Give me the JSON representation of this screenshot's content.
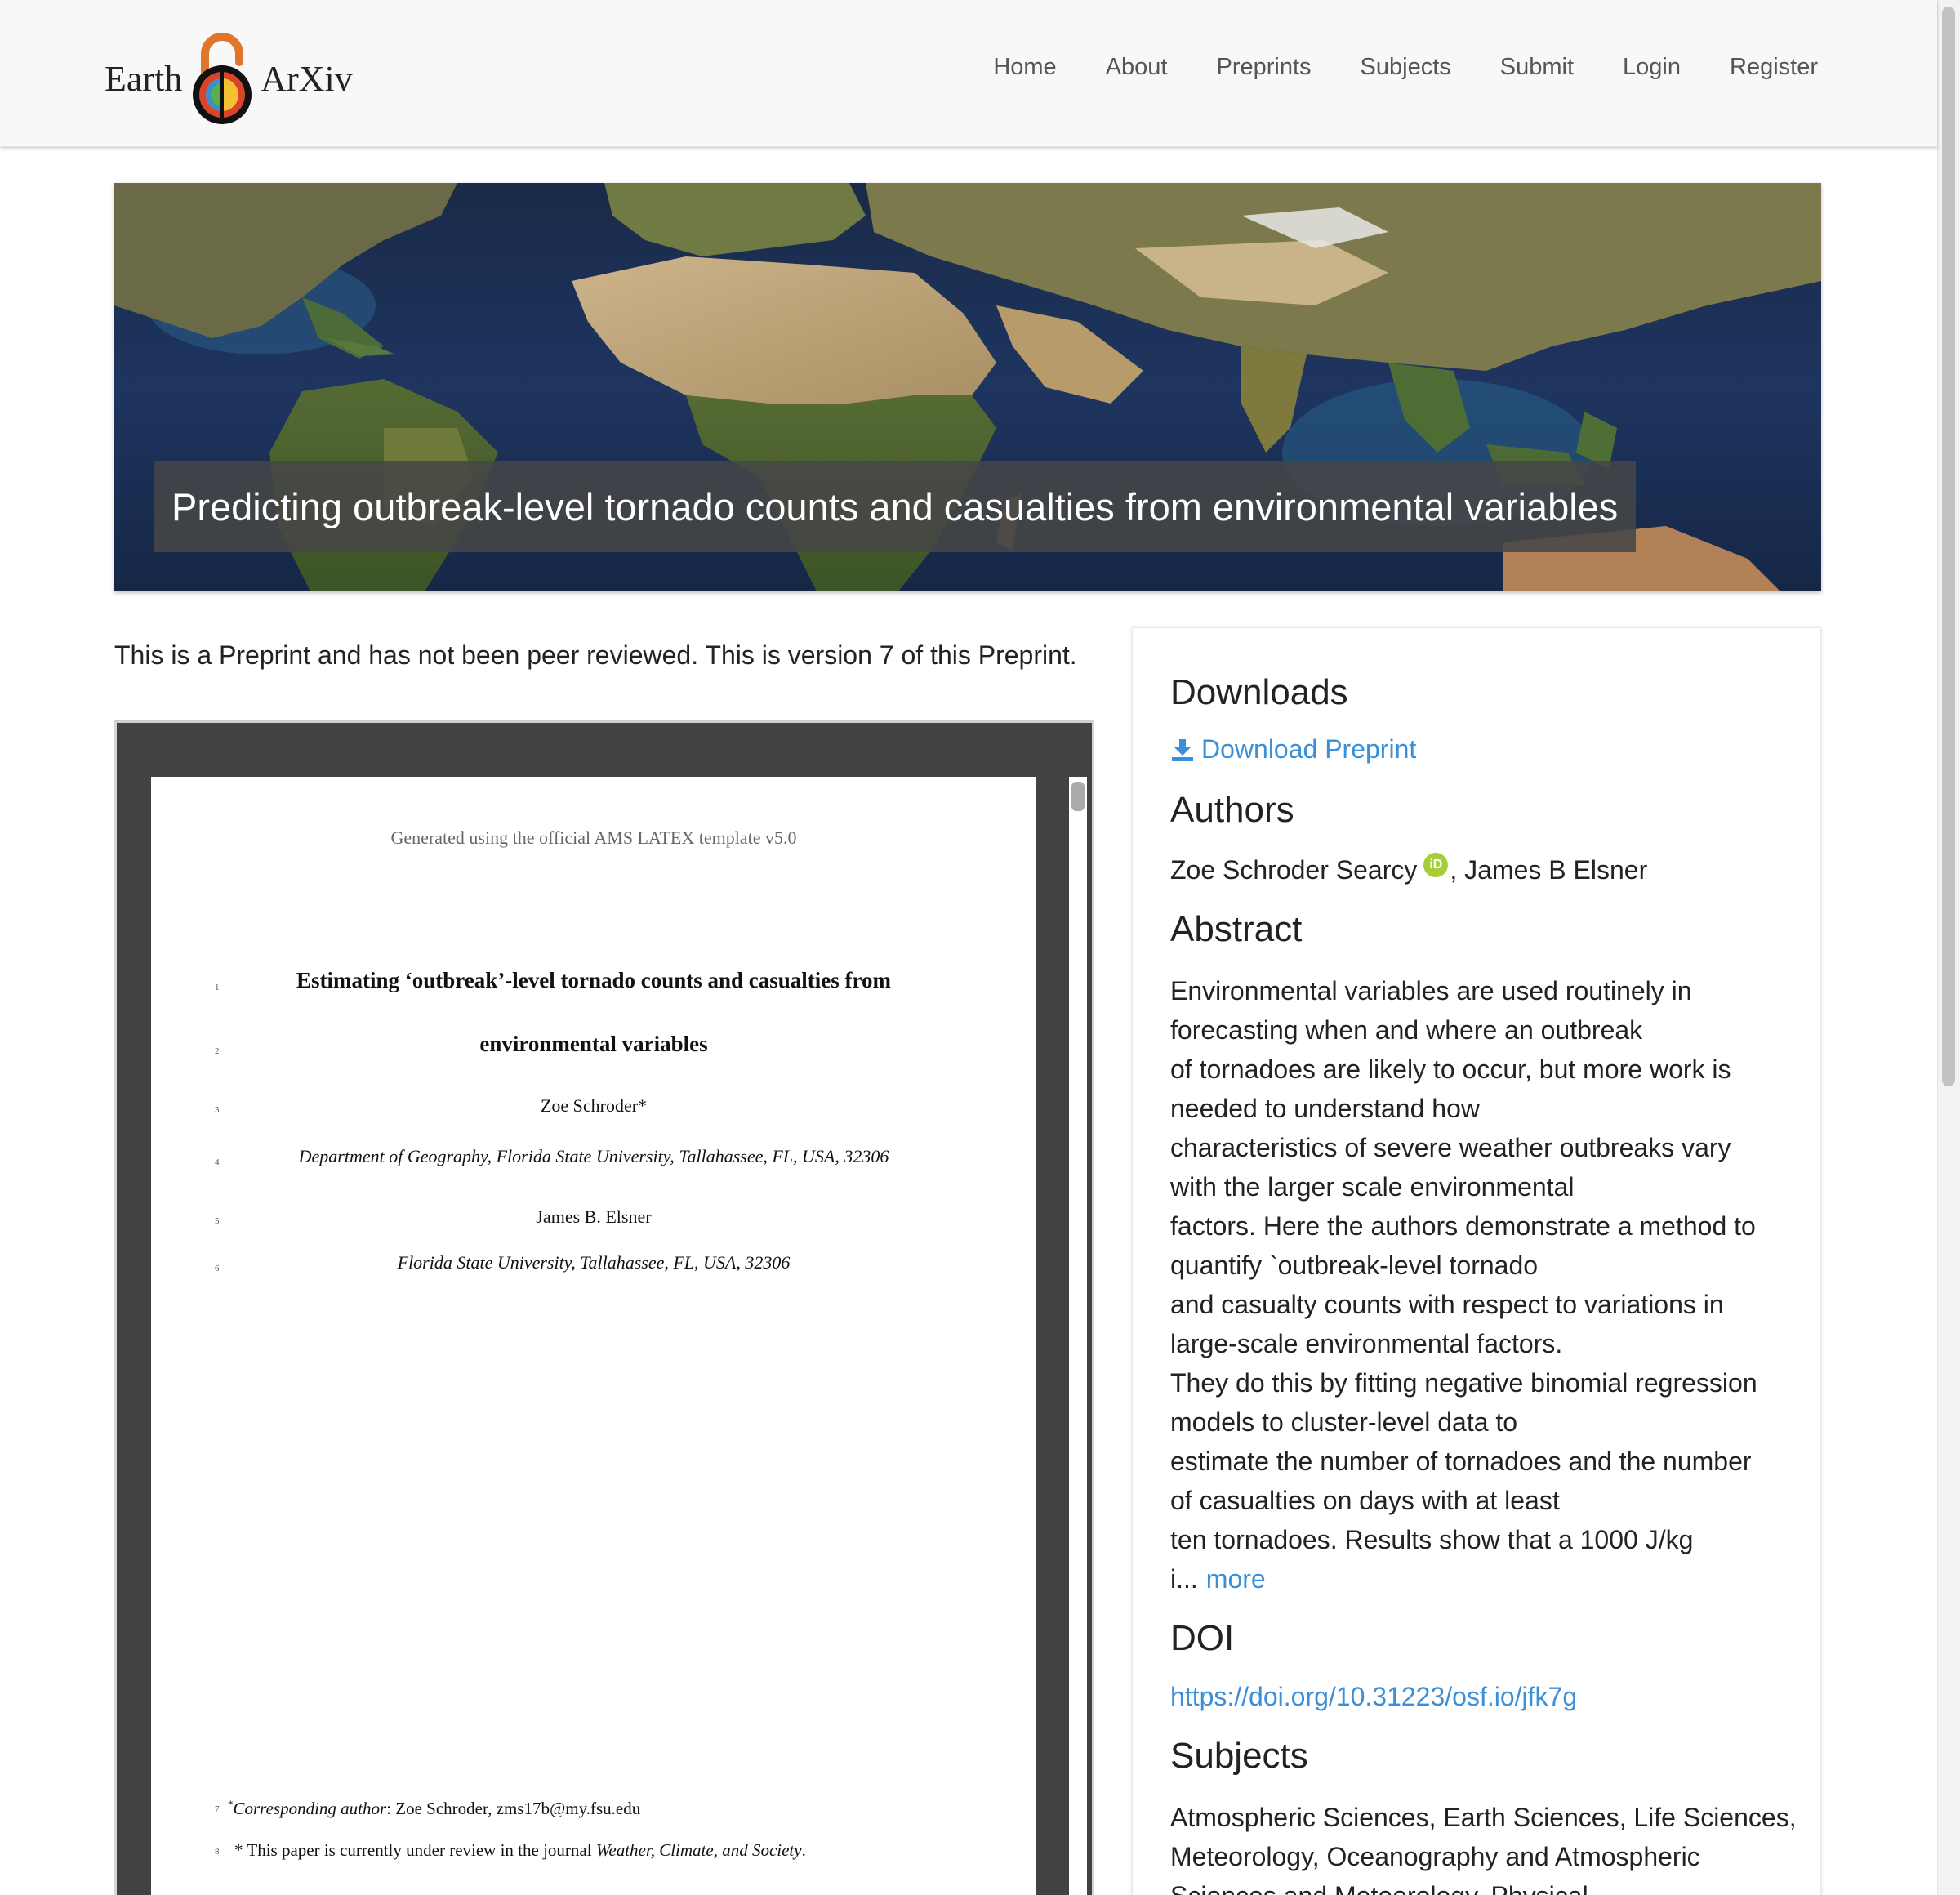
{
  "navbar": {
    "logo_left": "Earth",
    "logo_right": "ArXiv",
    "links": [
      "Home",
      "About",
      "Preprints",
      "Subjects",
      "Submit",
      "Login",
      "Register"
    ]
  },
  "banner": {
    "title": "Predicting outbreak-level tornado counts and casualties from environmental variables"
  },
  "notice": "This is a Preprint and has not been peer reviewed. This is version 7 of this Preprint.",
  "pdf": {
    "header": "Generated using the official AMS LATEX template v5.0",
    "title_line1": "Estimating ‘outbreak’-level tornado counts and casualties from",
    "title_line2": "environmental variables",
    "author1": "Zoe Schroder*",
    "affil1": "Department of Geography, Florida State University, Tallahassee, FL, USA, 32306",
    "author2": "James B. Elsner",
    "affil2": "Florida State University, Tallahassee, FL, USA, 32306",
    "footnote1_label": "Corresponding author",
    "footnote1_text": ": Zoe Schroder, zms17b@my.fsu.edu",
    "footnote2_text": "* This paper is currently under review in the journal ",
    "footnote2_journal": "Weather, Climate, and Society",
    "line_numbers": [
      "1",
      "2",
      "3",
      "4",
      "5",
      "6",
      "7",
      "8"
    ]
  },
  "sidebar": {
    "downloads_heading": "Downloads",
    "download_label": "Download Preprint",
    "download_icon": "download-icon",
    "authors_heading": "Authors",
    "author1": "Zoe Schroder Searcy",
    "orcid_badge": "iD",
    "author2": ", James B Elsner",
    "abstract_heading": "Abstract",
    "abstract_lines": [
      "Environmental variables are used routinely in",
      "forecasting when and where an outbreak",
      "of tornadoes are likely to occur, but more work is",
      "needed to understand how",
      "characteristics of severe weather outbreaks vary",
      "with the larger scale environmental",
      "factors. Here the authors demonstrate a method to",
      "quantify `outbreak-level tornado",
      "and casualty counts with respect to variations in",
      "large-scale environmental factors.",
      "They do this by fitting negative binomial regression",
      "models to cluster-level data to",
      "estimate the number of tornadoes and the number",
      "of casualties on days with at least",
      "ten tornadoes. Results show that a 1000 J/kg"
    ],
    "abstract_tail": "i...",
    "more_label": "more",
    "doi_heading": "DOI",
    "doi_link": "https://doi.org/10.31223/osf.io/jfk7g",
    "subjects_heading": "Subjects",
    "subjects_text": "Atmospheric Sciences, Earth Sciences, Life Sciences, Meteorology, Oceanography and Atmospheric Sciences and Meteorology, Physical"
  },
  "colors": {
    "link": "#3b8fd8",
    "navbar_bg": "#f8f8f8",
    "viewer_bg": "#424242",
    "orcid": "#a6ce39"
  }
}
